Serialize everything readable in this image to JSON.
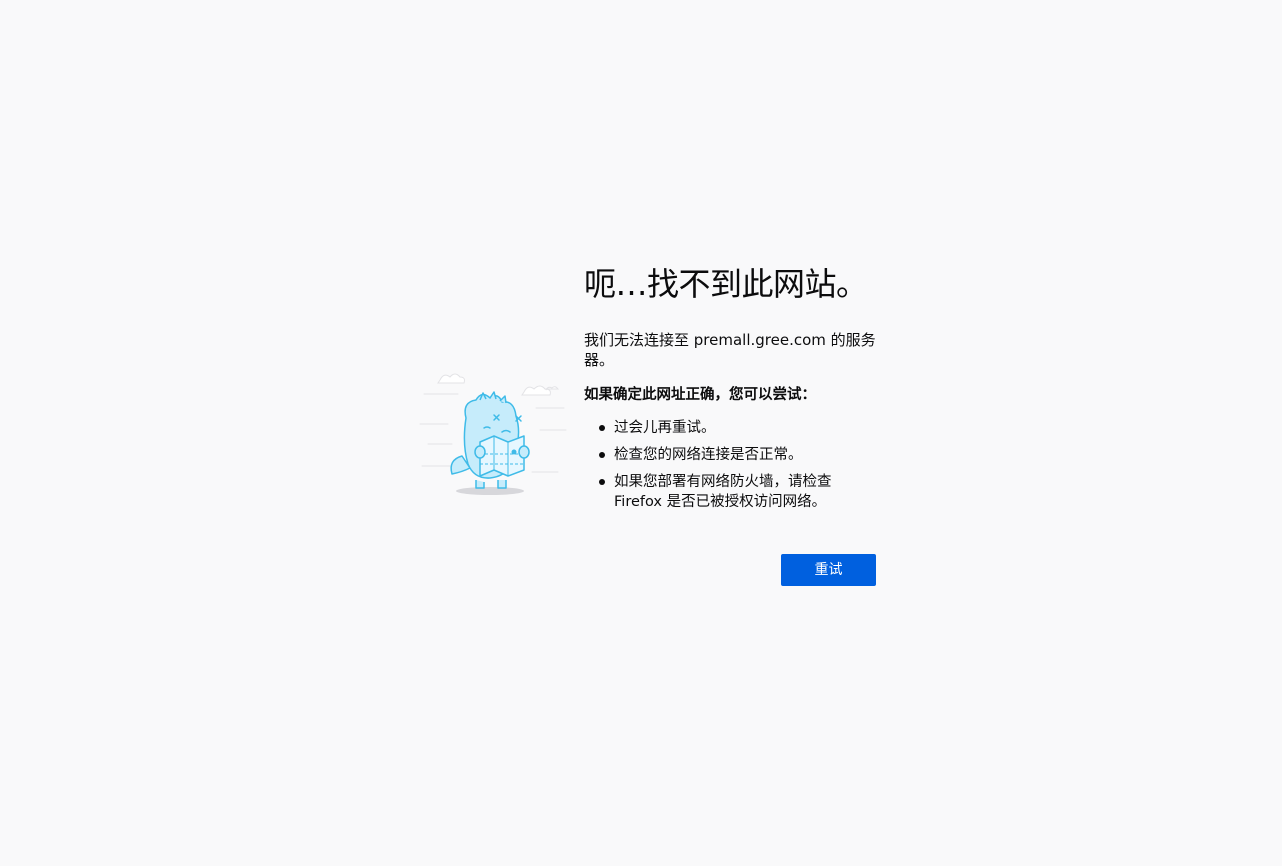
{
  "error_page": {
    "title": "呃…找不到此网站。",
    "description": "我们无法连接至 premall.gree.com 的服务器。",
    "try_heading": "如果确定此网址正确，您可以尝试：",
    "tips": [
      "过会儿再重试。",
      "检查您的网络连接是否正常。",
      "如果您部署有网络防火墙，请检查 Firefox 是否已被授权访问网络。"
    ],
    "retry_label": "重试"
  },
  "illustration": {
    "icon": "confused-dinosaur-with-map-icon"
  },
  "colors": {
    "background": "#f9f9fa",
    "text": "#0c0c0d",
    "button": "#0060df",
    "illustration_fill": "#c6ecfb",
    "illustration_stroke": "#3fbbe8"
  }
}
